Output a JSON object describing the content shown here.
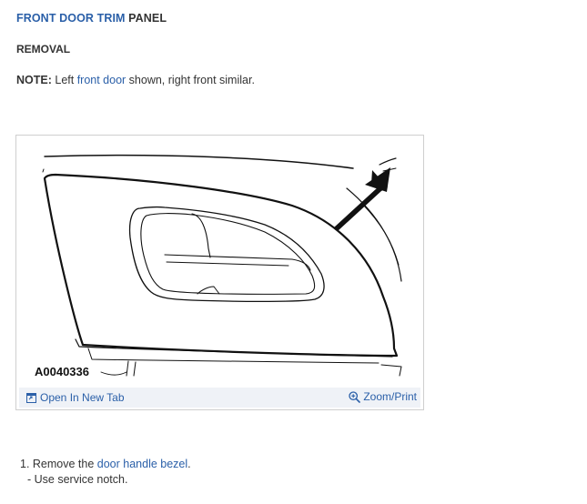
{
  "header": {
    "title_link": "FRONT DOOR TRIM",
    "title_rest": " PANEL",
    "section": "REMOVAL"
  },
  "note": {
    "label": "NOTE:",
    "text_before": " Left ",
    "link": "front door",
    "text_after": " shown, right front similar."
  },
  "figure": {
    "image_id": "A0040336",
    "open_new_tab": "Open In New Tab",
    "zoom_print": "Zoom/Print"
  },
  "steps": {
    "step1_prefix": "1. Remove the ",
    "step1_link": "door handle bezel",
    "step1_suffix": ".",
    "substep1": "-  Use service notch."
  },
  "colors": {
    "link": "#2a5fa8",
    "text": "#333333",
    "bar_bg": "#eff2f7"
  }
}
